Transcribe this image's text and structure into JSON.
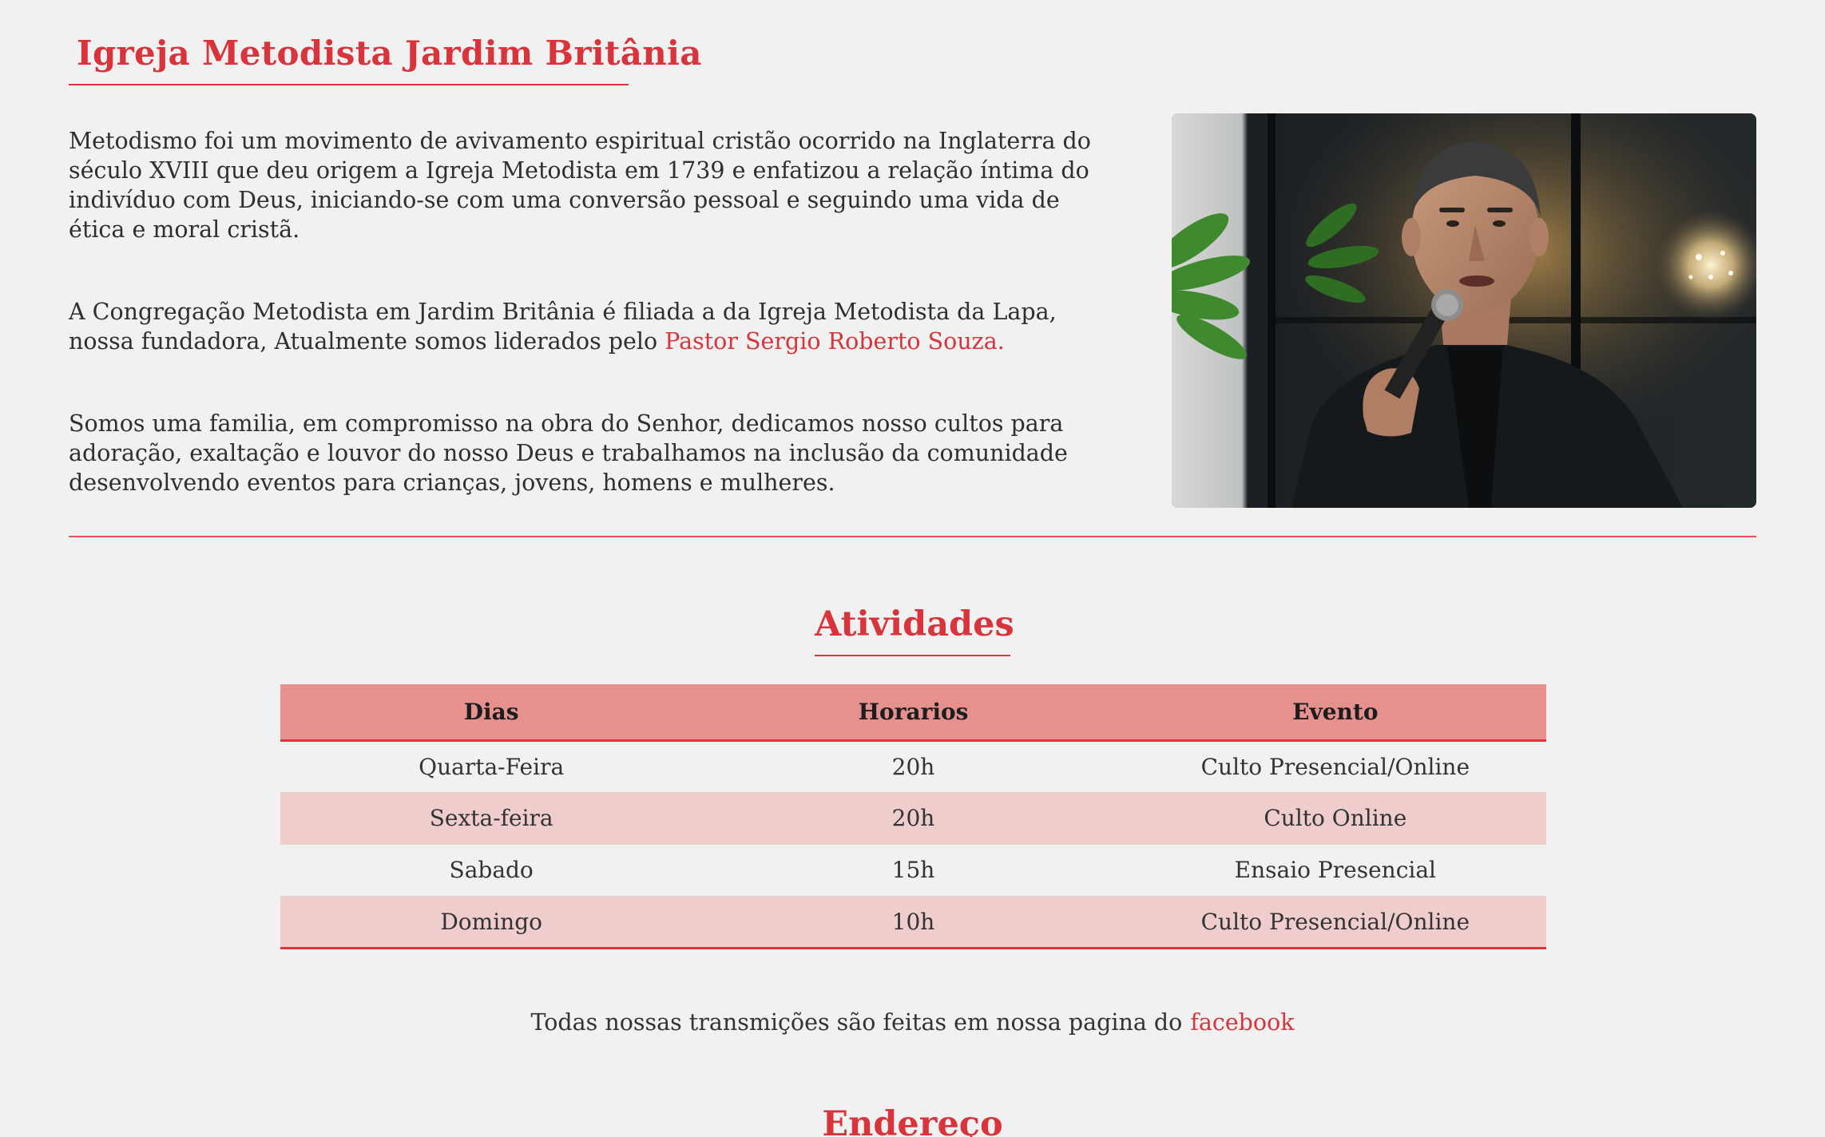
{
  "header": {
    "title": "Igreja Metodista Jardim Britânia"
  },
  "intro": {
    "paragraph1": "Metodismo foi um movimento de avivamento espiritual cristão ocorrido na Inglaterra do século XVIII que deu origem a Igreja Metodista em 1739 e enfatizou a relação íntima do indivíduo com Deus, iniciando-se com uma conversão pessoal e seguindo uma vida de ética e moral cristã.",
    "paragraph2_text": "A Congregação Metodista em Jardim Britânia é filiada a da Igreja Metodista da Lapa, nossa fundadora, Atualmente somos liderados pelo ",
    "paragraph2_link": "Pastor Sergio Roberto Souza.",
    "paragraph3": "Somos uma familia, em compromisso na obra do Senhor, dedicamos nosso cultos para adoração, exaltação e louvor do nosso Deus e trabalhamos na inclusão da comunidade desenvolvendo eventos para crianças, jovens, homens e mulheres."
  },
  "activities": {
    "heading": "Atividades",
    "columns": [
      "Dias",
      "Horarios",
      "Evento"
    ],
    "rows": [
      [
        "Quarta-Feira",
        "20h",
        "Culto Presencial/Online"
      ],
      [
        "Sexta-feira",
        "20h",
        "Culto Online"
      ],
      [
        "Sabado",
        "15h",
        "Ensaio Presencial"
      ],
      [
        "Domingo",
        "10h",
        "Culto Presencial/Online"
      ]
    ]
  },
  "facebook_note": {
    "text": "Todas nossas transmições são feitas em nossa pagina do",
    "link": "facebook"
  },
  "address": {
    "heading": "Endereço"
  },
  "colors": {
    "accent": "#d9343c",
    "table_header": "#e79090",
    "table_row_alt": "#f0cdcd",
    "background": "#f1f1f1"
  }
}
